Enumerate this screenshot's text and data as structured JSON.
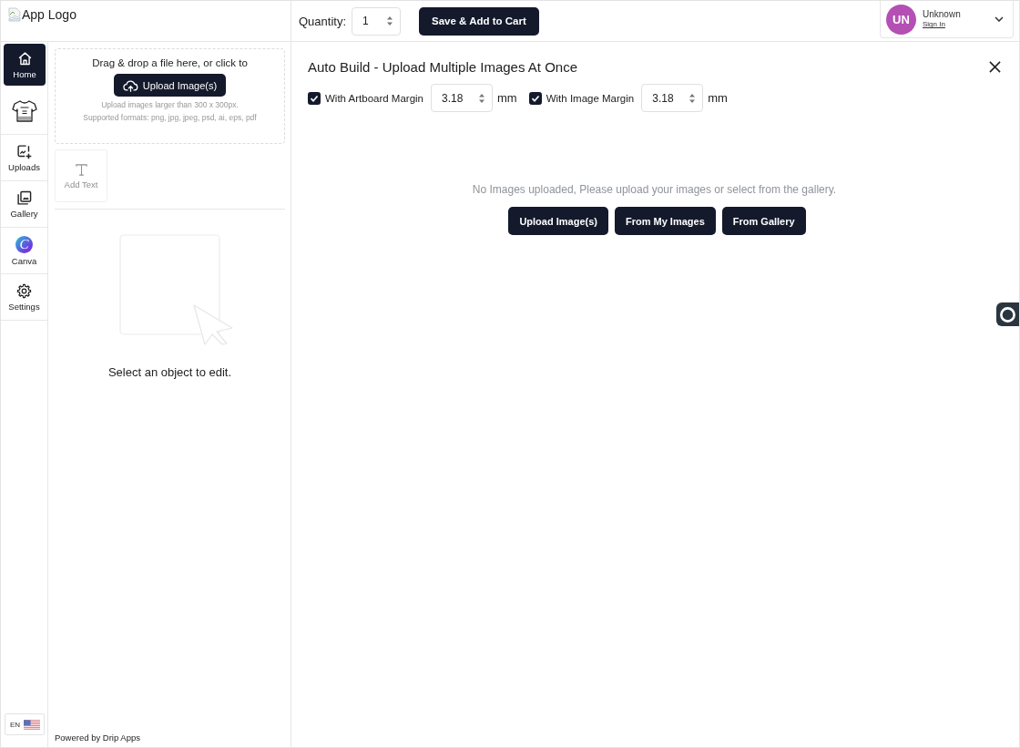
{
  "header": {
    "logo_alt": "App Logo"
  },
  "top_bar": {
    "quantity": {
      "label": "Quantity:",
      "value": "1"
    },
    "save_button": "Save & Add to Cart",
    "user": {
      "initials": "UN",
      "name": "Unknown",
      "link": "Sign In"
    }
  },
  "sidebar": {
    "items": [
      {
        "kind": "home",
        "label": "Home",
        "selected": true
      },
      {
        "kind": "jersey",
        "selected": false
      },
      {
        "kind": "uploads",
        "label": "Uploads",
        "selected": false
      },
      {
        "kind": "gallery",
        "label": "Gallery",
        "selected": false
      },
      {
        "kind": "canva",
        "label": "Canva",
        "logo_letter": "C",
        "selected": false
      },
      {
        "kind": "settings",
        "label": "Settings",
        "selected": false
      }
    ],
    "language": "EN"
  },
  "panel": {
    "upload_zone": {
      "prompt": "Drag & drop a file here, or click to",
      "button": "Upload Image(s)",
      "hints": [
        "Upload images larger than 300 x 300px.",
        "Supported formats: png, jpg, jpeg, psd, ai, eps, pdf"
      ]
    },
    "tools": [
      {
        "kind": "text",
        "label": "Add Text",
        "disabled": true
      }
    ],
    "empty_state": "Select an object to edit.",
    "footer": "Powered by Drip Apps"
  },
  "main": {
    "title": "Auto Build - Upload Multiple Images At Once",
    "options": [
      {
        "label": "With Artboard Margin",
        "checked": true,
        "value": "3.18",
        "unit": "mm"
      },
      {
        "label": "With Image Margin",
        "checked": true,
        "value": "3.18",
        "unit": "mm"
      }
    ],
    "empty_message": "No Images uploaded, Please upload your images or select from the gallery.",
    "buttons": [
      "Upload Image(s)",
      "From My Images",
      "From Gallery"
    ]
  }
}
